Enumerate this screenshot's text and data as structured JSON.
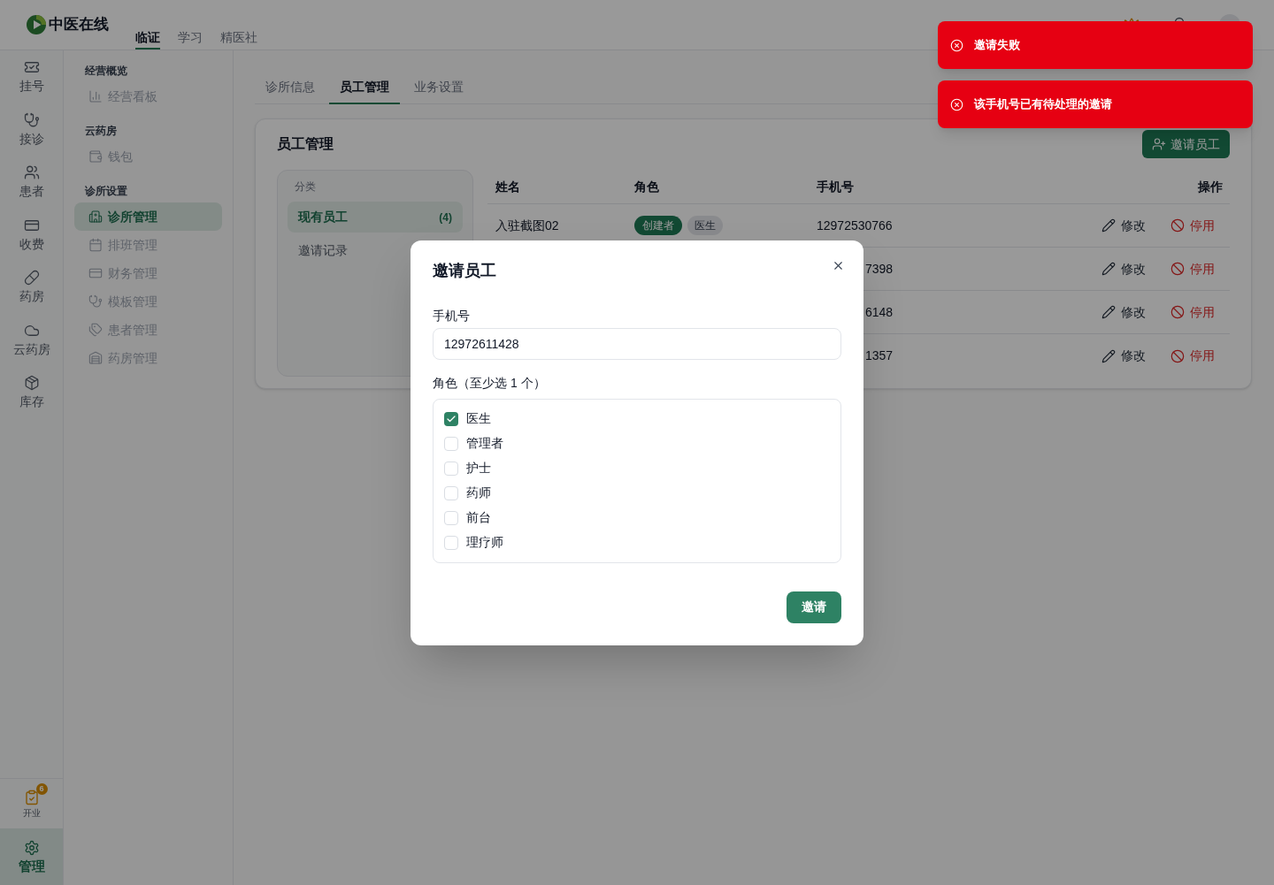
{
  "header": {
    "logo_text": "中医在线",
    "nav": [
      {
        "label": "临证",
        "selected": true
      },
      {
        "label": "学习",
        "selected": false
      },
      {
        "label": "精医社",
        "selected": false
      }
    ]
  },
  "rail": {
    "items": [
      {
        "label": "挂号",
        "selected": false
      },
      {
        "label": "接诊",
        "selected": false
      },
      {
        "label": "患者",
        "selected": false
      },
      {
        "label": "收费",
        "selected": false
      },
      {
        "label": "药房",
        "selected": false
      },
      {
        "label": "云药房",
        "selected": false
      },
      {
        "label": "库存",
        "selected": false
      }
    ],
    "bottom": [
      {
        "kind": "shortcut",
        "label": "开业",
        "badge": "6",
        "selected": false
      },
      {
        "kind": "nav",
        "label": "管理",
        "selected": true
      }
    ]
  },
  "sidebar": {
    "sections": [
      {
        "title": "经营概览",
        "items": [
          {
            "label": "经营看板",
            "selected": false
          }
        ]
      },
      {
        "title": "云药房",
        "items": [
          {
            "label": "钱包",
            "selected": false
          }
        ]
      },
      {
        "title": "诊所设置",
        "items": [
          {
            "label": "诊所管理",
            "selected": true
          },
          {
            "label": "排班管理",
            "selected": false
          },
          {
            "label": "财务管理",
            "selected": false
          },
          {
            "label": "模板管理",
            "selected": false
          },
          {
            "label": "患者管理",
            "selected": false
          },
          {
            "label": "药房管理",
            "selected": false
          }
        ]
      }
    ]
  },
  "tabs": [
    {
      "label": "诊所信息",
      "selected": false
    },
    {
      "label": "员工管理",
      "selected": true
    },
    {
      "label": "业务设置",
      "selected": false
    }
  ],
  "staff_card": {
    "title": "员工管理",
    "invite_button": "邀请员工",
    "categories": {
      "title": "分类",
      "items": [
        {
          "label": "现有员工",
          "count": "(4)",
          "selected": true
        },
        {
          "label": "邀请记录",
          "selected": false
        }
      ]
    },
    "table": {
      "columns": [
        "姓名",
        "角色",
        "手机号",
        "操作"
      ],
      "rows": [
        {
          "name": "入驻截图02",
          "roles": [
            {
              "label": "创建者",
              "kind": "owner"
            },
            {
              "label": "医生",
              "kind": "role"
            }
          ],
          "phone": "12972530766",
          "actions": [
            {
              "label": "修改",
              "kind": "edit"
            },
            {
              "label": "停用",
              "kind": "disable"
            }
          ]
        },
        {
          "phone": "7398",
          "actions": [
            {
              "label": "修改",
              "kind": "edit"
            },
            {
              "label": "停用",
              "kind": "disable"
            }
          ]
        },
        {
          "phone": "6148",
          "actions": [
            {
              "label": "修改",
              "kind": "edit"
            },
            {
              "label": "停用",
              "kind": "disable"
            }
          ]
        },
        {
          "phone": "1357",
          "actions": [
            {
              "label": "修改",
              "kind": "edit"
            },
            {
              "label": "停用",
              "kind": "disable"
            }
          ]
        }
      ]
    }
  },
  "modal": {
    "title": "邀请员工",
    "phone": {
      "label": "手机号",
      "value": "12972611428"
    },
    "roles": {
      "label": "角色（至少选 1 个）",
      "options": [
        {
          "label": "医生",
          "checked": true
        },
        {
          "label": "管理者",
          "checked": false
        },
        {
          "label": "护士",
          "checked": false
        },
        {
          "label": "药师",
          "checked": false
        },
        {
          "label": "前台",
          "checked": false
        },
        {
          "label": "理疗师",
          "checked": false
        }
      ]
    },
    "submit": "邀请"
  },
  "toasts": [
    {
      "message": "邀请失败"
    },
    {
      "message": "该手机号已有待处理的邀请"
    }
  ]
}
